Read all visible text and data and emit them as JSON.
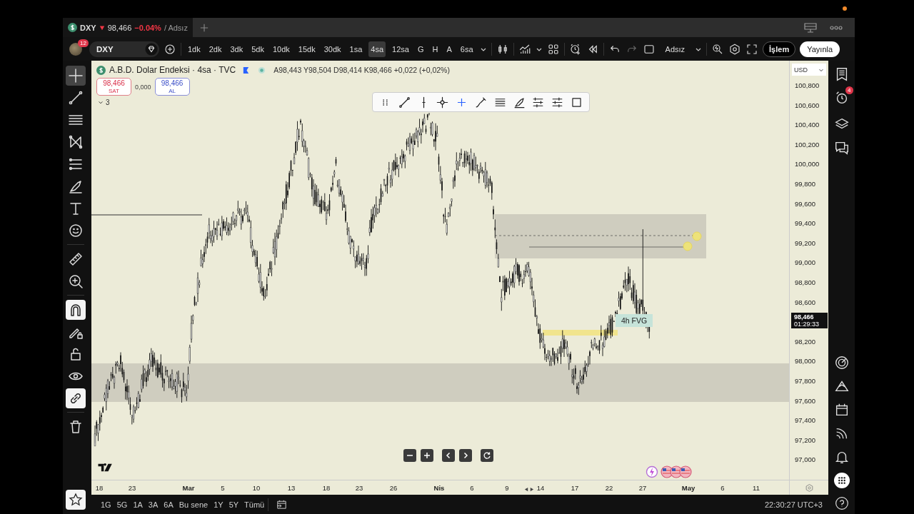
{
  "tab": {
    "symbol": "DXY",
    "falling": true,
    "price": "98,466",
    "change": "−0.04%",
    "layout": "/ Adsız"
  },
  "toolbar": {
    "avatar_badge": "12",
    "symbol": "DXY",
    "intervals": [
      {
        "label": "1dk",
        "selected": false
      },
      {
        "label": "2dk",
        "selected": false
      },
      {
        "label": "3dk",
        "selected": false
      },
      {
        "label": "5dk",
        "selected": false
      },
      {
        "label": "10dk",
        "selected": false
      },
      {
        "label": "15dk",
        "selected": false
      },
      {
        "label": "30dk",
        "selected": false
      },
      {
        "label": "1sa",
        "selected": false
      },
      {
        "label": "4sa",
        "selected": true
      },
      {
        "label": "12sa",
        "selected": false
      },
      {
        "label": "G",
        "selected": false
      },
      {
        "label": "H",
        "selected": false
      },
      {
        "label": "A",
        "selected": false
      },
      {
        "label": "6sa",
        "selected": false
      }
    ],
    "layout_name": "Adsız",
    "trade_button": "İşlem",
    "publish_button": "Yayınla"
  },
  "left_tools": [
    [
      {
        "kind": "crosshair",
        "active": true
      },
      {
        "kind": "trendline",
        "active": false
      },
      {
        "kind": "lines",
        "active": false
      },
      {
        "kind": "pattern",
        "active": false
      },
      {
        "kind": "fib",
        "active": false
      },
      {
        "kind": "brush",
        "active": false
      },
      {
        "kind": "text",
        "active": false
      },
      {
        "kind": "emoji",
        "active": false
      }
    ],
    [
      {
        "kind": "ruler",
        "active": false
      },
      {
        "kind": "zoom",
        "active": false
      }
    ],
    [
      {
        "kind": "magnet",
        "active": true
      },
      {
        "kind": "pencil-lock",
        "active": false
      },
      {
        "kind": "lock",
        "active": false
      },
      {
        "kind": "eye",
        "active": false
      },
      {
        "kind": "link",
        "active": true
      }
    ],
    [
      {
        "kind": "trash",
        "active": false
      }
    ]
  ],
  "legend": {
    "title": "A.B.D. Dolar Endeksi · 4sa · TVC",
    "ohlc": "A98,443 Y98,504 D98,414 K98,466 +0,022 (+0,02%)",
    "sell_price": "98,466",
    "sell_label": "SAT",
    "spread": "0,000",
    "buy_price": "98,466",
    "buy_label": "AL",
    "indicators_count": "3"
  },
  "chart": {
    "zone_label": "4h FVG"
  },
  "price_axis": {
    "currency": "USD",
    "labels": [
      "100,800",
      "100,600",
      "100,400",
      "100,200",
      "100,000",
      "99,800",
      "99,600",
      "99,400",
      "99,200",
      "99,000",
      "98,800",
      "98,600",
      "98,200",
      "98,000",
      "97,800",
      "97,600",
      "97,400",
      "97,200",
      "97,000"
    ],
    "last_price": "98,466",
    "countdown": "01:29:33"
  },
  "time_axis": [
    {
      "label": "18",
      "kind": "day"
    },
    {
      "label": "23",
      "kind": "day"
    },
    {
      "label": "Mar",
      "kind": "month"
    },
    {
      "label": "5",
      "kind": "day"
    },
    {
      "label": "10",
      "kind": "day"
    },
    {
      "label": "13",
      "kind": "day"
    },
    {
      "label": "18",
      "kind": "day"
    },
    {
      "label": "23",
      "kind": "day"
    },
    {
      "label": "26",
      "kind": "day"
    },
    {
      "label": "Nis",
      "kind": "month"
    },
    {
      "label": "6",
      "kind": "day"
    },
    {
      "label": "9",
      "kind": "day"
    },
    {
      "label": "14",
      "kind": "day"
    },
    {
      "label": "17",
      "kind": "day"
    },
    {
      "label": "22",
      "kind": "day"
    },
    {
      "label": "27",
      "kind": "day"
    },
    {
      "label": "May",
      "kind": "month"
    },
    {
      "label": "6",
      "kind": "day"
    },
    {
      "label": "11",
      "kind": "day"
    }
  ],
  "range_buttons": [
    "1G",
    "5G",
    "1A",
    "3A",
    "6A",
    "Bu sene",
    "1Y",
    "5Y",
    "Tümü"
  ],
  "clock": "22:30:27 UTC+3",
  "right_sidebar": {
    "alerts_badge": "4"
  }
}
